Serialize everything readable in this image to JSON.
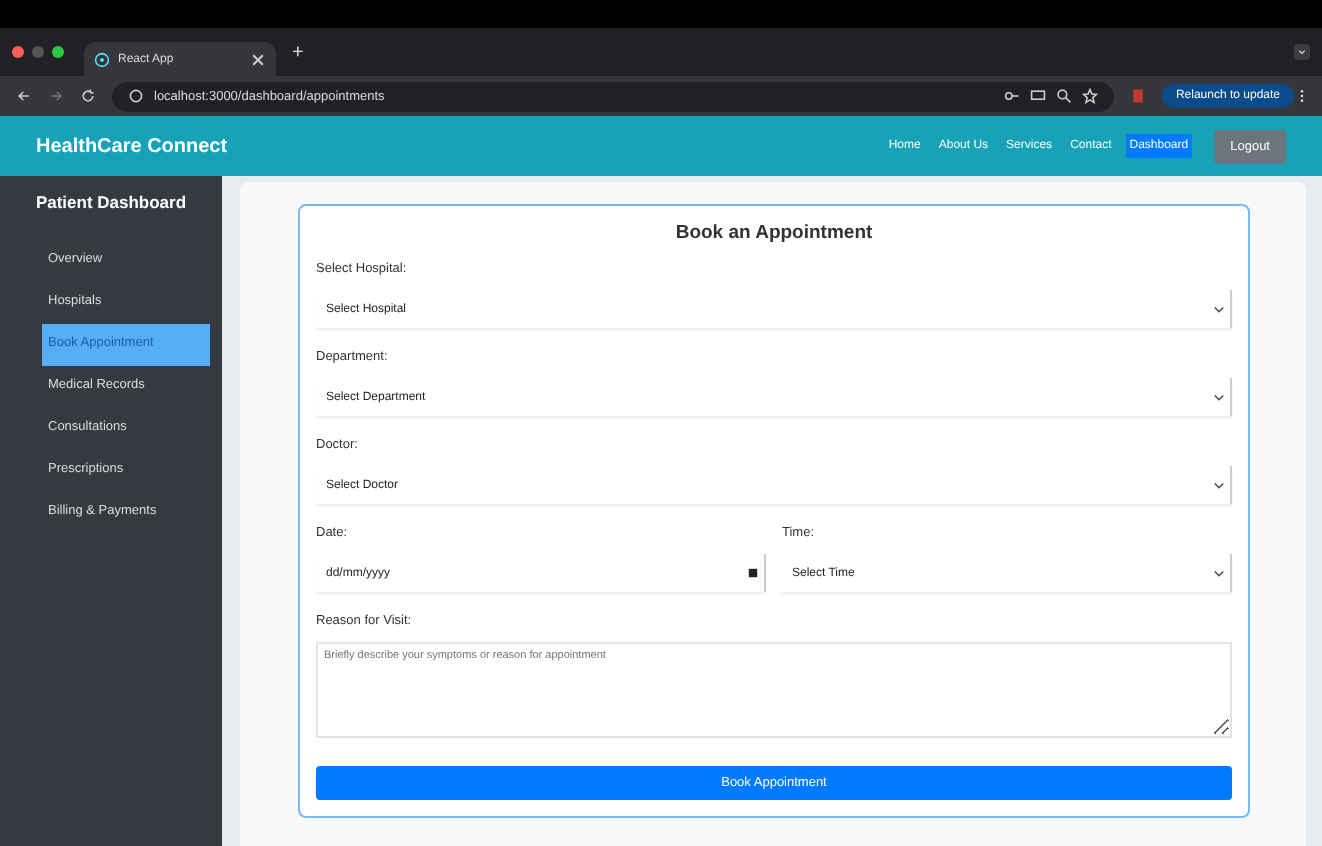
{
  "browser": {
    "tab_title": "React App",
    "new_tab": "+",
    "url": "localhost:3000/dashboard/appointments",
    "relaunch": "Relaunch to update"
  },
  "header": {
    "brand": "HealthCare Connect",
    "nav": [
      {
        "label": "Home",
        "selected": false
      },
      {
        "label": "About Us",
        "selected": false
      },
      {
        "label": "Services",
        "selected": false
      },
      {
        "label": "Contact",
        "selected": false
      },
      {
        "label": "Dashboard",
        "selected": true
      }
    ],
    "logout": "Logout"
  },
  "sidebar": {
    "title": "Patient Dashboard",
    "items": [
      {
        "label": "Overview",
        "selected": false
      },
      {
        "label": "Hospitals",
        "selected": false
      },
      {
        "label": "Book Appointment",
        "selected": true
      },
      {
        "label": "Medical Records",
        "selected": false
      },
      {
        "label": "Consultations",
        "selected": false
      },
      {
        "label": "Prescriptions",
        "selected": false
      },
      {
        "label": "Billing & Payments",
        "selected": false
      }
    ]
  },
  "form": {
    "title": "Book an Appointment",
    "rows": [
      {
        "fields": [
          {
            "kind": "select",
            "label": "Select Hospital:",
            "value": "Select Hospital"
          }
        ]
      },
      {
        "fields": [
          {
            "kind": "select",
            "label": "Department:",
            "value": "Select Department"
          }
        ]
      },
      {
        "fields": [
          {
            "kind": "select",
            "label": "Doctor:",
            "value": "Select Doctor"
          }
        ]
      },
      {
        "fields": [
          {
            "kind": "date",
            "label": "Date:",
            "value": "dd/mm/yyyy"
          },
          {
            "kind": "select",
            "label": "Time:",
            "value": "Select Time"
          }
        ]
      },
      {
        "fields": [
          {
            "kind": "textarea",
            "label": "Reason for Visit:",
            "placeholder": "Briefly describe your symptoms or reason for appointment"
          }
        ]
      }
    ],
    "submit": "Book Appointment"
  }
}
